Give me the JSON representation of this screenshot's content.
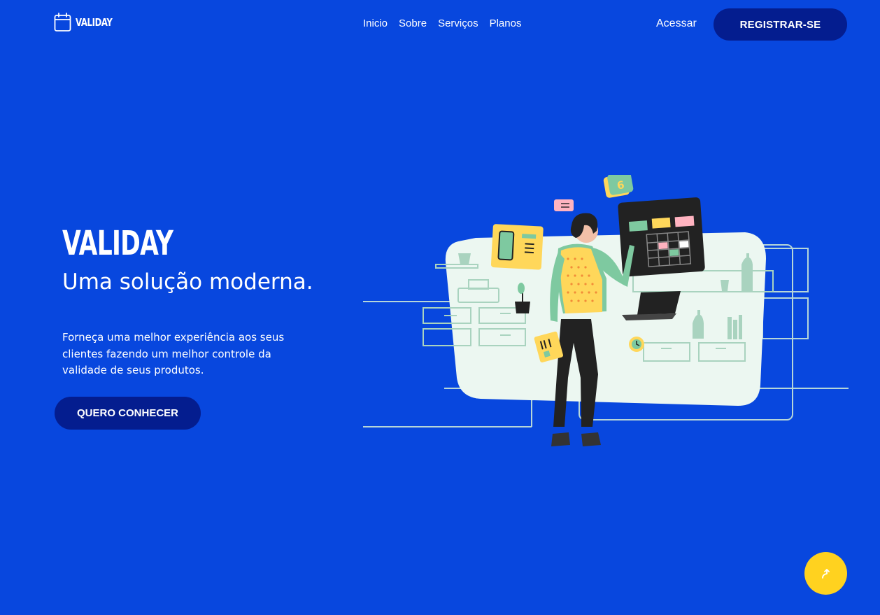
{
  "brand": {
    "name": "VALIDAY"
  },
  "nav": {
    "items": [
      "Inicio",
      "Sobre",
      "Serviços",
      "Planos"
    ]
  },
  "auth": {
    "login_label": "Acessar",
    "register_label": "REGISTRAR-SE"
  },
  "hero": {
    "title": "VALIDAY",
    "subtitle": "Uma solução moderna.",
    "description": "Forneça uma melhor experiência aos seus clientes fazendo um melhor controle da validade de seus produtos.",
    "cta_label": "QUERO CONHECER"
  },
  "illustration": {
    "calendar_badge": "6"
  },
  "colors": {
    "background": "#0847de",
    "button_dark": "#041d8f",
    "accent_yellow": "#ffd21f",
    "text": "#ffffff"
  },
  "icons": {
    "logo": "calendar-icon",
    "scroll_top": "arrow-up-icon"
  }
}
